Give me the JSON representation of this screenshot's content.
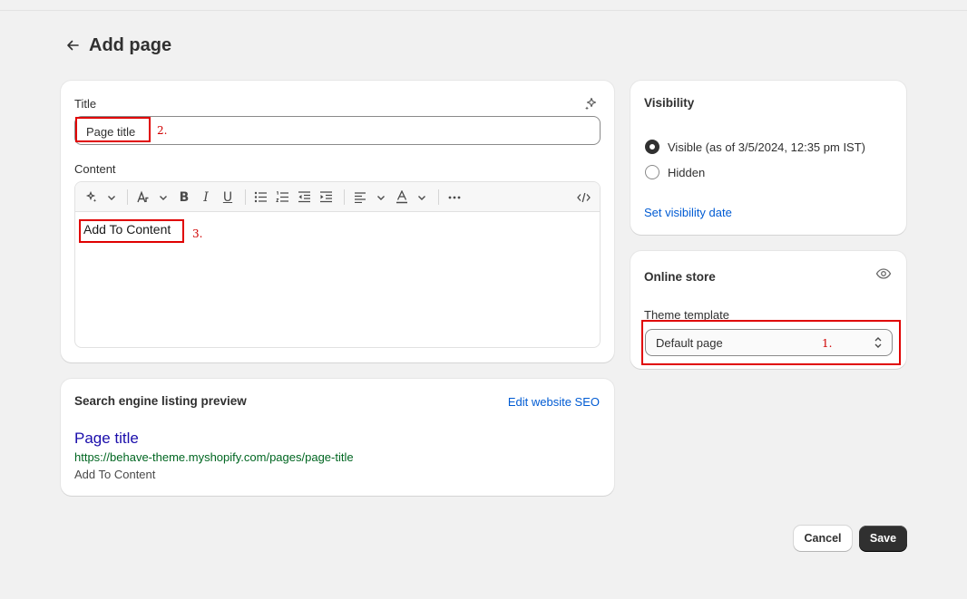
{
  "header": {
    "title": "Add page"
  },
  "main": {
    "title_label": "Title",
    "title_value": "Page title",
    "content_label": "Content",
    "content_value": "Add To Content"
  },
  "seo": {
    "heading": "Search engine listing preview",
    "edit_link": "Edit website SEO",
    "preview_title": "Page title",
    "preview_url": "https://behave-theme.myshopify.com/pages/page-title",
    "preview_description": "Add To Content"
  },
  "visibility": {
    "heading": "Visibility",
    "options": [
      {
        "label": "Visible (as of 3/5/2024, 12:35 pm IST)",
        "selected": true
      },
      {
        "label": "Hidden",
        "selected": false
      }
    ],
    "set_date_link": "Set visibility date"
  },
  "online_store": {
    "heading": "Online store",
    "template_label": "Theme template",
    "template_value": "Default page"
  },
  "annotations": {
    "one": "1.",
    "two": "2.",
    "three": "3."
  },
  "actions": {
    "cancel": "Cancel",
    "save": "Save"
  },
  "colors": {
    "accent_link": "#005bd3",
    "seo_title": "#1a0dab",
    "seo_url": "#006621",
    "annotation_red": "#e00000"
  }
}
